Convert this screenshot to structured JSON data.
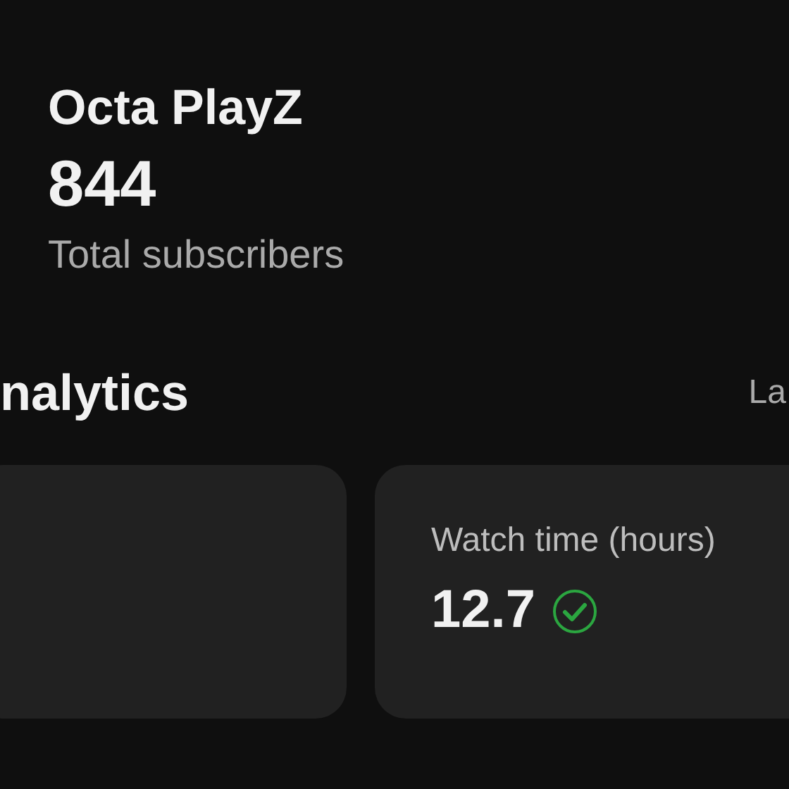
{
  "channel": {
    "name": "Octa PlayZ",
    "subscribers": "844",
    "subscribers_label": "Total subscribers"
  },
  "analytics": {
    "title": "nalytics",
    "period": "La"
  },
  "cards": [
    {
      "kind": "empty"
    },
    {
      "kind": "metric",
      "label": "Watch time (hours)",
      "value": "12.7",
      "checked": true
    }
  ]
}
